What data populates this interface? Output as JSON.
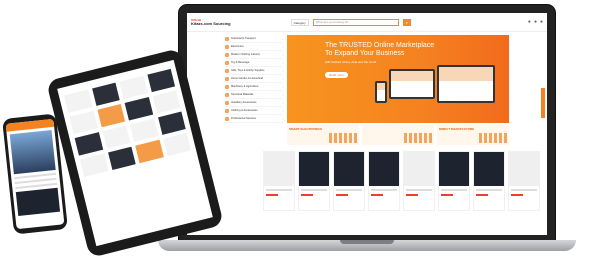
{
  "laptop": {
    "logo_top": "Official",
    "logo_main": "Kitazs.com Sourcing",
    "logo_cn": "",
    "category_select": "Category",
    "search_placeholder": "What are you looking for...",
    "menu": [
      "Industrial & Transport",
      "Electronics",
      "Modern Clothing Industry",
      "Toy & Beverage",
      "Gifts, Toys & Hobby Supplies",
      "Home Garden & Household",
      "Machinery & Agriculture",
      "Structural Materials",
      "Jewellery Accessories",
      "Clothing & Accessories",
      "Professional Services"
    ],
    "banner": {
      "title_line1": "The TRUSTED Online Marketplace",
      "title_line2": "To Expand Your Business",
      "subtitle": "with Verified China, Asia and the world",
      "button": "Read more"
    },
    "promos": [
      "SMART ELECTRONICS",
      "",
      "DIRECT MANUFACTURE"
    ]
  }
}
